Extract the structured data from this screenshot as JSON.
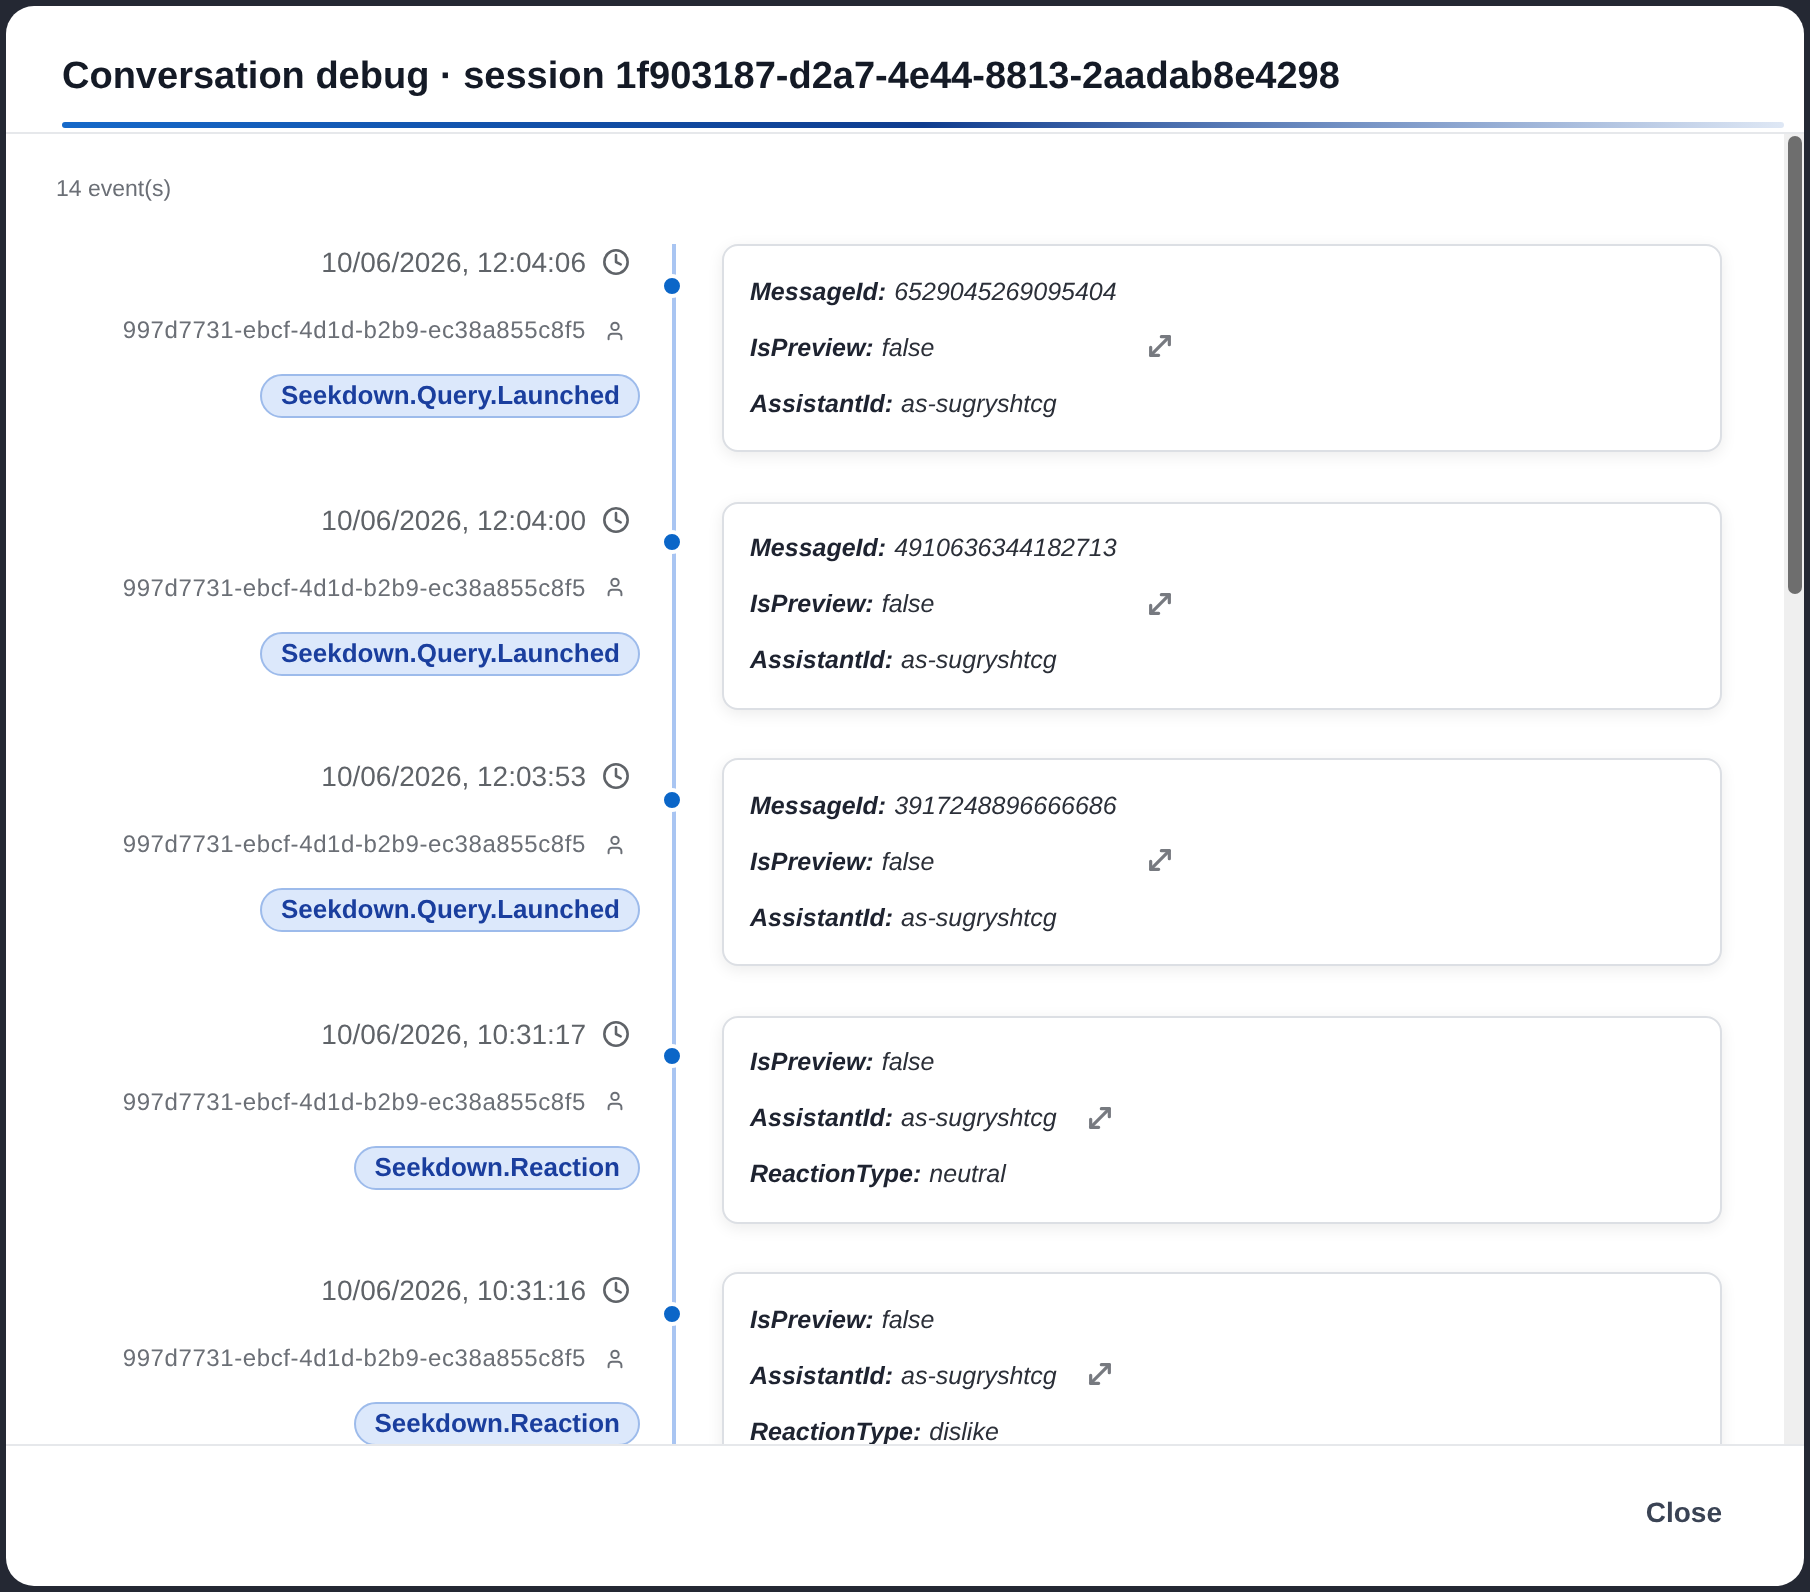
{
  "dialog": {
    "title": "Conversation debug · session 1f903187-d2a7-4e44-8813-2aadab8e4298",
    "event_count": "14 event(s)",
    "events": [
      {
        "time": "10/06/2026, 12:04:06",
        "user": "997d7731-ebcf-4d1d-b2b9-ec38a855c8f5",
        "type": "Seekdown.Query.Launched",
        "fields": [
          {
            "label": "MessageId:",
            "value": "6529045269095404"
          },
          {
            "label": "IsPreview:",
            "value": "false"
          },
          {
            "label": "AssistantId:",
            "value": "as-sugryshtcg"
          }
        ]
      },
      {
        "time": "10/06/2026, 12:04:00",
        "user": "997d7731-ebcf-4d1d-b2b9-ec38a855c8f5",
        "type": "Seekdown.Query.Launched",
        "fields": [
          {
            "label": "MessageId:",
            "value": "4910636344182713"
          },
          {
            "label": "IsPreview:",
            "value": "false"
          },
          {
            "label": "AssistantId:",
            "value": "as-sugryshtcg"
          }
        ]
      },
      {
        "time": "10/06/2026, 12:03:53",
        "user": "997d7731-ebcf-4d1d-b2b9-ec38a855c8f5",
        "type": "Seekdown.Query.Launched",
        "fields": [
          {
            "label": "MessageId:",
            "value": "3917248896666686"
          },
          {
            "label": "IsPreview:",
            "value": "false"
          },
          {
            "label": "AssistantId:",
            "value": "as-sugryshtcg"
          }
        ]
      },
      {
        "time": "10/06/2026, 10:31:17",
        "user": "997d7731-ebcf-4d1d-b2b9-ec38a855c8f5",
        "type": "Seekdown.Reaction",
        "fields": [
          {
            "label": "IsPreview:",
            "value": "false"
          },
          {
            "label": "AssistantId:",
            "value": "as-sugryshtcg"
          },
          {
            "label": "ReactionType:",
            "value": "neutral"
          }
        ]
      },
      {
        "time": "10/06/2026, 10:31:16",
        "user": "997d7731-ebcf-4d1d-b2b9-ec38a855c8f5",
        "type": "Seekdown.Reaction",
        "fields": [
          {
            "label": "IsPreview:",
            "value": "false"
          },
          {
            "label": "AssistantId:",
            "value": "as-sugryshtcg"
          },
          {
            "label": "ReactionType:",
            "value": "dislike"
          }
        ]
      }
    ],
    "close_button": "Close"
  }
}
